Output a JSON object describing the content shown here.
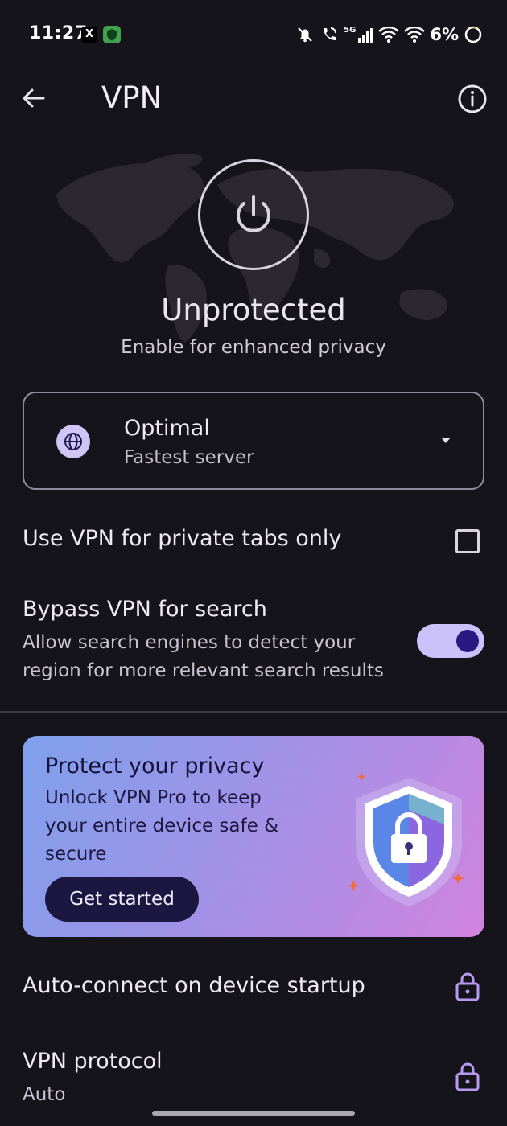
{
  "status_bar": {
    "time": "11:27",
    "x_app_icon": "X",
    "network": "5G",
    "battery": "6%"
  },
  "app_bar": {
    "title": "VPN",
    "back_icon": "arrow-left-icon",
    "info_icon": "info-circle-icon"
  },
  "hero": {
    "status": "Unprotected",
    "subtitle": "Enable for enhanced privacy"
  },
  "server": {
    "name": "Optimal",
    "description": "Fastest server"
  },
  "settings": {
    "private_tabs_label": "Use VPN for private tabs only",
    "private_tabs_checked": false,
    "bypass_label": "Bypass VPN for search",
    "bypass_description": "Allow search engines to detect your region for more relevant search results",
    "bypass_enabled": true
  },
  "promo": {
    "title": "Protect your privacy",
    "text": "Unlock VPN Pro to keep your entire device safe & secure",
    "button": "Get started"
  },
  "locked_settings": {
    "auto_connect_label": "Auto-connect on device startup",
    "protocol_label": "VPN protocol",
    "protocol_value": "Auto"
  },
  "colors": {
    "background": "#16141b",
    "accent": "#cbc2fb",
    "toggle_knob": "#281880",
    "lock_icon": "#b79af0"
  }
}
